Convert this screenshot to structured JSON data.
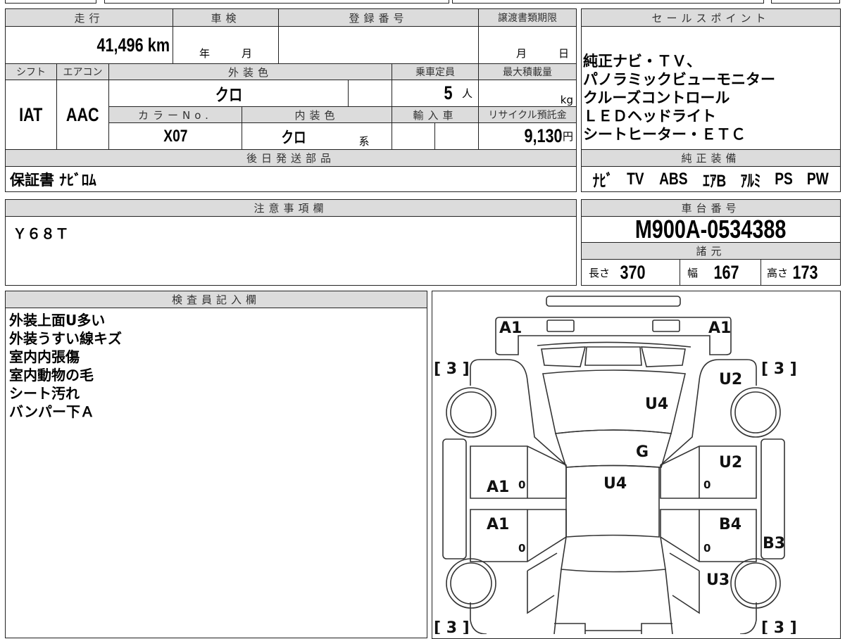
{
  "header_labels": {
    "mileage": "走行",
    "inspection": "車検",
    "registration": "登録番号",
    "transfer_deadline": "譲渡書類期限",
    "shift": "シフト",
    "aircon": "エアコン",
    "exterior_color": "外装色",
    "capacity": "乗車定員",
    "max_load": "最大積載量",
    "color_no": "カラーNo.",
    "interior_color": "内装色",
    "imported": "輸入車",
    "recycle_fee": "リサイクル預託金",
    "later_parts": "後日発送部品",
    "sales_point": "セールスポイント",
    "oem_equipment": "純正装備",
    "notes": "注意事項欄",
    "chassis_no": "車台番号",
    "specs": "諸元",
    "inspector": "検査員記入欄"
  },
  "values": {
    "mileage": "41,496",
    "mileage_unit": "km",
    "year_label": "年",
    "month_label": "月",
    "deadline_month": "月",
    "deadline_day": "日",
    "shift": "IAT",
    "aircon": "AAC",
    "exterior_color": "クロ",
    "capacity": "5",
    "capacity_unit": "人",
    "load_unit": "kg",
    "color_no": "X07",
    "interior_color": "クロ",
    "interior_suffix": "系",
    "recycle_fee": "9,130",
    "recycle_unit": "円",
    "later_parts": "保証書 ﾅﾋﾞﾛﾑ",
    "notes": "Ｙ６８Ｔ",
    "chassis_no": "M900A-0534388"
  },
  "sales_points": [
    "純正ナビ・ＴＶ、",
    "パノラミックビューモニター",
    "クルーズコントロール",
    "ＬＥＤヘッドライト",
    "シートヒーター・ＥＴＣ"
  ],
  "equipment": [
    "ﾅﾋﾞ",
    "TV",
    "ABS",
    "ｴｱB",
    "ｱﾙﾐ",
    "PS",
    "PW"
  ],
  "specs": {
    "length_label": "長さ",
    "length": "370",
    "width_label": "幅",
    "width": "167",
    "height_label": "高さ",
    "height": "173"
  },
  "inspector_notes": [
    "外装上面U多い",
    "外装うすい線キズ",
    "室内内張傷",
    "室内動物の毛",
    "シート汚れ",
    "バンパー下Ａ"
  ],
  "diagram_marks": [
    "A1",
    "A1",
    "[ 3 ]",
    "[ 3 ]",
    "U2",
    "U4",
    "G",
    "U2",
    "U4",
    "A1",
    "A1",
    "B4",
    "B3",
    "U3",
    "[ 3 ]",
    "[ 3 ]",
    "0",
    "0",
    "0",
    "0"
  ]
}
